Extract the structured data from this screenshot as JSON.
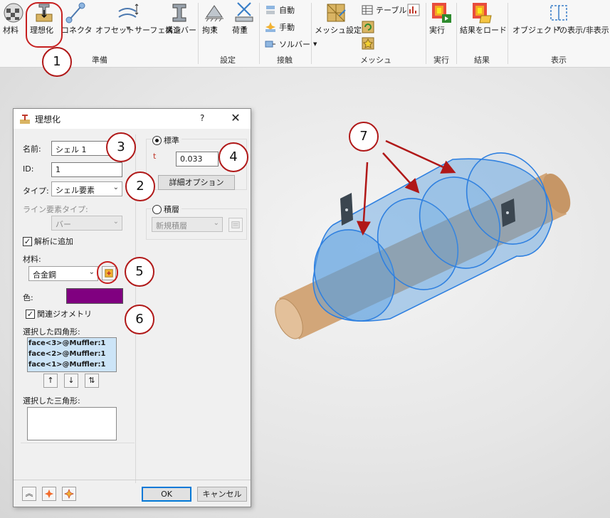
{
  "ribbon": {
    "buttons": [
      {
        "id": "material",
        "label": "材料"
      },
      {
        "id": "idealize",
        "label": "理想化"
      },
      {
        "id": "connector",
        "label": "コネクタ"
      },
      {
        "id": "offset-surface",
        "label": "オフセットサーフェス"
      },
      {
        "id": "struct-member",
        "label": "構造",
        "label2": "メンバー"
      },
      {
        "id": "constraint",
        "label": "拘束"
      },
      {
        "id": "load",
        "label": "荷重"
      },
      {
        "id": "mesh-settings",
        "label": "メッシュ設定"
      },
      {
        "id": "run",
        "label": "実行"
      },
      {
        "id": "load-results",
        "label": "結果をロード"
      },
      {
        "id": "show-hide",
        "label": "オブジェクトの表示/非表示"
      }
    ],
    "small": {
      "auto": "自動",
      "manual": "手動",
      "solver": "ソルバー",
      "table": "テーブル"
    },
    "groups": {
      "prep": "準備",
      "settings": "設定",
      "contact": "接触",
      "mesh": "メッシュ",
      "run": "実行",
      "results": "結果",
      "display": "表示"
    }
  },
  "dialog": {
    "title": "理想化",
    "help": "?",
    "close": "✕",
    "name_label": "名前:",
    "name_value": "シェル 1",
    "id_label": "ID:",
    "id_value": "1",
    "type_label": "タイプ:",
    "type_value": "シェル要素",
    "line_type_label": "ライン要素タイプ:",
    "line_type_value": "バー",
    "add_to_analysis": "解析に追加",
    "material_label": "材料:",
    "material_value": "合金鋼",
    "color_label": "色:",
    "color_value": "#800080",
    "assoc_geometry": "関連ジオメトリ",
    "quad_label": "選択した四角形:",
    "quads": [
      "face<3>@Muffler:1",
      "face<2>@Muffler:1",
      "face<1>@Muffler:1"
    ],
    "tri_label": "選択した三角形:",
    "standard": "標準",
    "t_label": "t",
    "t_value": "0.033",
    "detail_options": "詳細オプション",
    "laminate": "積層",
    "new_laminate": "新規積層",
    "ok": "OK",
    "cancel": "キャンセル"
  },
  "callouts": [
    "1",
    "2",
    "3",
    "4",
    "5",
    "6",
    "7"
  ],
  "colors": {
    "accent": "#0078d7",
    "callout": "#b01818",
    "shell": "#5b9fe0",
    "rod": "#d2a679"
  }
}
